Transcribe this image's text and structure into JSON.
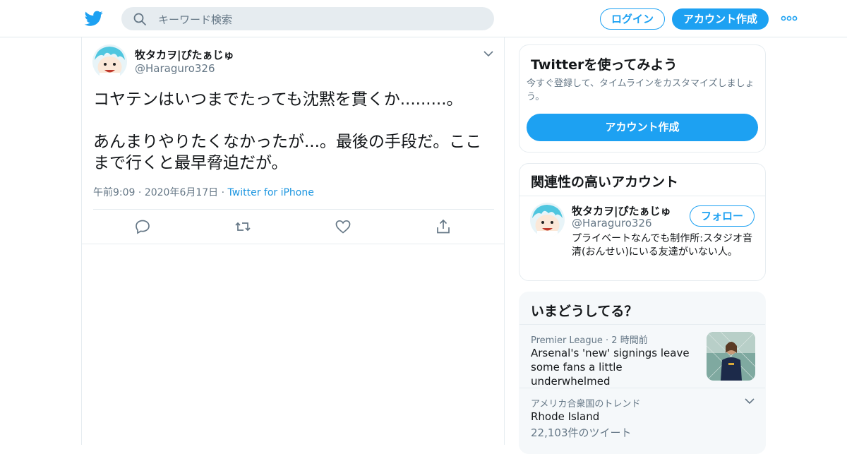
{
  "header": {
    "logo_icon": "twitter-bird-icon",
    "search_placeholder": "キーワード検索",
    "login_label": "ログイン",
    "signup_label": "アカウント作成",
    "more_icon": "more-dots-icon",
    "accent_color": "#1da1f2"
  },
  "tweet": {
    "display_name": "牧タカヲ|ぴたぁじゅ",
    "handle": "@Haraguro326",
    "text": "コヤテンはいつまでたっても沈黙を貫くか.........。\n\nあんまりやりたくなかったが...。最後の手段だ。ここまで行くと最早脅迫だが。",
    "time": "午前9:09",
    "date": "2020年6月17日",
    "source": "Twitter for iPhone",
    "actions": [
      "reply-icon",
      "retweet-icon",
      "like-icon",
      "share-icon"
    ]
  },
  "signup_card": {
    "title": "Twitterを使ってみよう",
    "subtitle": "今すぐ登録して、タイムラインをカスタマイズしましょう。",
    "button_label": "アカウント作成"
  },
  "relevant_card": {
    "title": "関連性の高いアカウント",
    "account": {
      "display_name": "牧タカヲ|ぴたぁじゅ",
      "handle": "@Haraguro326",
      "follow_label": "フォロー",
      "bio": "プライベートなんでも制作所:スタジオ音清(おんせい)にいる友達がいない人。"
    }
  },
  "trends_card": {
    "title": "いまどうしてる？",
    "items": [
      {
        "category": "Premier League",
        "time": "2 時間前",
        "title": "Arsenal's 'new' signings leave some fans a little underwhelmed"
      },
      {
        "category": "アメリカ合衆国のトレンド",
        "title": "Rhode Island",
        "count": "22,103件のツイート"
      }
    ]
  }
}
